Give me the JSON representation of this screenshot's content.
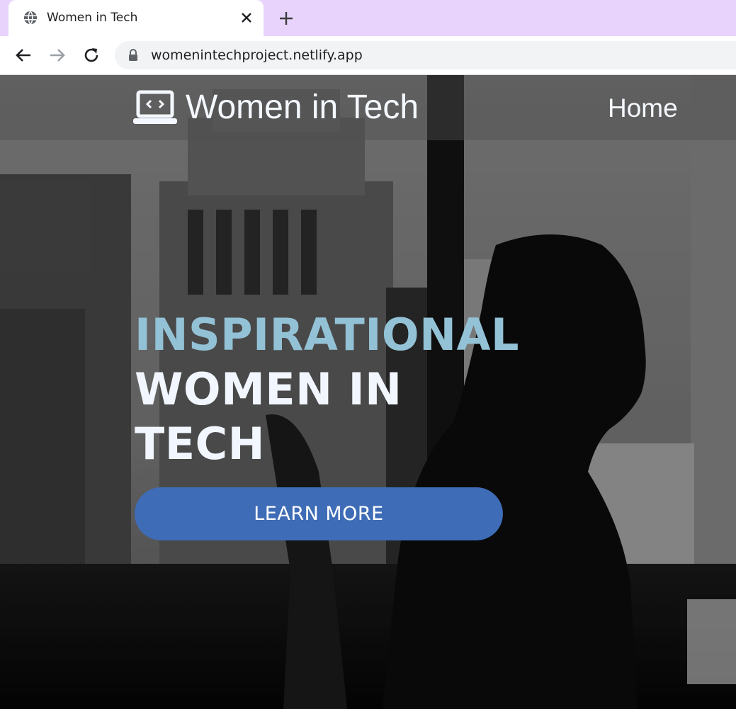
{
  "browser": {
    "tab_title": "Women in Tech",
    "url": "womenintechproject.netlify.app"
  },
  "site": {
    "brand": "Women in Tech",
    "nav_home": "Home",
    "hero": {
      "heading_accent": "INSPIRATIONAL",
      "heading_line2": "WOMEN IN",
      "heading_line3": "TECH",
      "cta": "LEARN MORE"
    }
  },
  "colors": {
    "tab_strip": "#e8d3fc",
    "heading_accent": "#93c2d6",
    "cta_button": "#3e6cb6"
  },
  "icons": {
    "tab_favicon": "globe-icon",
    "tab_close": "close-icon",
    "new_tab": "plus-icon",
    "back": "back-arrow-icon",
    "forward": "forward-arrow-icon",
    "reload": "reload-icon",
    "lock": "lock-icon",
    "brand": "laptop-code-icon"
  }
}
